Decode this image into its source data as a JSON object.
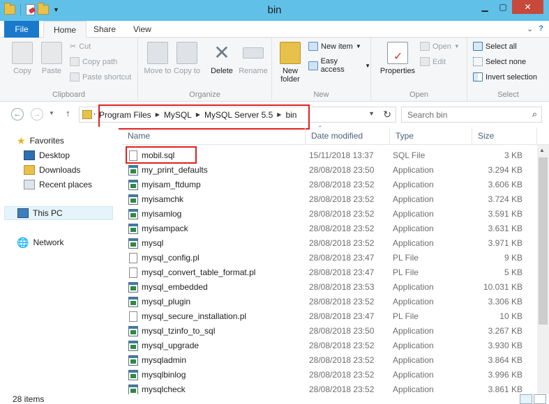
{
  "window": {
    "title": "bin"
  },
  "tabs": {
    "file": "File",
    "home": "Home",
    "share": "Share",
    "view": "View"
  },
  "ribbon": {
    "clipboard": {
      "label": "Clipboard",
      "copy": "Copy",
      "paste": "Paste",
      "cut": "Cut",
      "copy_path": "Copy path",
      "paste_shortcut": "Paste shortcut"
    },
    "organize": {
      "label": "Organize",
      "move_to": "Move to",
      "copy_to": "Copy to",
      "delete": "Delete",
      "rename": "Rename"
    },
    "new": {
      "label": "New",
      "new_folder": "New folder",
      "new_item": "New item",
      "easy_access": "Easy access"
    },
    "open": {
      "label": "Open",
      "properties": "Properties",
      "open": "Open",
      "edit": "Edit"
    },
    "select": {
      "label": "Select",
      "select_all": "Select all",
      "select_none": "Select none",
      "invert": "Invert selection"
    }
  },
  "address": {
    "crumbs": [
      "Program Files",
      "MySQL",
      "MySQL Server 5.5",
      "bin"
    ],
    "search_placeholder": "Search bin"
  },
  "nav": {
    "favorites": "Favorites",
    "desktop": "Desktop",
    "downloads": "Downloads",
    "recent": "Recent places",
    "this_pc": "This PC",
    "network": "Network"
  },
  "columns": {
    "name": "Name",
    "date": "Date modified",
    "type": "Type",
    "size": "Size"
  },
  "files": [
    {
      "name": "mobil.sql",
      "date": "15/11/2018 13:37",
      "type": "SQL File",
      "size": "3 KB",
      "icon": "doc"
    },
    {
      "name": "my_print_defaults",
      "date": "28/08/2018 23:50",
      "type": "Application",
      "size": "3.294 KB",
      "icon": "app"
    },
    {
      "name": "myisam_ftdump",
      "date": "28/08/2018 23:52",
      "type": "Application",
      "size": "3.606 KB",
      "icon": "app"
    },
    {
      "name": "myisamchk",
      "date": "28/08/2018 23:52",
      "type": "Application",
      "size": "3.724 KB",
      "icon": "app"
    },
    {
      "name": "myisamlog",
      "date": "28/08/2018 23:52",
      "type": "Application",
      "size": "3.591 KB",
      "icon": "app"
    },
    {
      "name": "myisampack",
      "date": "28/08/2018 23:52",
      "type": "Application",
      "size": "3.631 KB",
      "icon": "app"
    },
    {
      "name": "mysql",
      "date": "28/08/2018 23:52",
      "type": "Application",
      "size": "3.971 KB",
      "icon": "app"
    },
    {
      "name": "mysql_config.pl",
      "date": "28/08/2018 23:47",
      "type": "PL File",
      "size": "9 KB",
      "icon": "doc"
    },
    {
      "name": "mysql_convert_table_format.pl",
      "date": "28/08/2018 23:47",
      "type": "PL File",
      "size": "5 KB",
      "icon": "doc"
    },
    {
      "name": "mysql_embedded",
      "date": "28/08/2018 23:53",
      "type": "Application",
      "size": "10.031 KB",
      "icon": "app"
    },
    {
      "name": "mysql_plugin",
      "date": "28/08/2018 23:52",
      "type": "Application",
      "size": "3.306 KB",
      "icon": "app"
    },
    {
      "name": "mysql_secure_installation.pl",
      "date": "28/08/2018 23:47",
      "type": "PL File",
      "size": "10 KB",
      "icon": "doc"
    },
    {
      "name": "mysql_tzinfo_to_sql",
      "date": "28/08/2018 23:50",
      "type": "Application",
      "size": "3.267 KB",
      "icon": "app"
    },
    {
      "name": "mysql_upgrade",
      "date": "28/08/2018 23:52",
      "type": "Application",
      "size": "3.930 KB",
      "icon": "app"
    },
    {
      "name": "mysqladmin",
      "date": "28/08/2018 23:52",
      "type": "Application",
      "size": "3.864 KB",
      "icon": "app"
    },
    {
      "name": "mysqlbinlog",
      "date": "28/08/2018 23:52",
      "type": "Application",
      "size": "3.996 KB",
      "icon": "app"
    },
    {
      "name": "mysqlcheck",
      "date": "28/08/2018 23:52",
      "type": "Application",
      "size": "3.861 KB",
      "icon": "app"
    }
  ],
  "status": {
    "count": "28 items"
  }
}
